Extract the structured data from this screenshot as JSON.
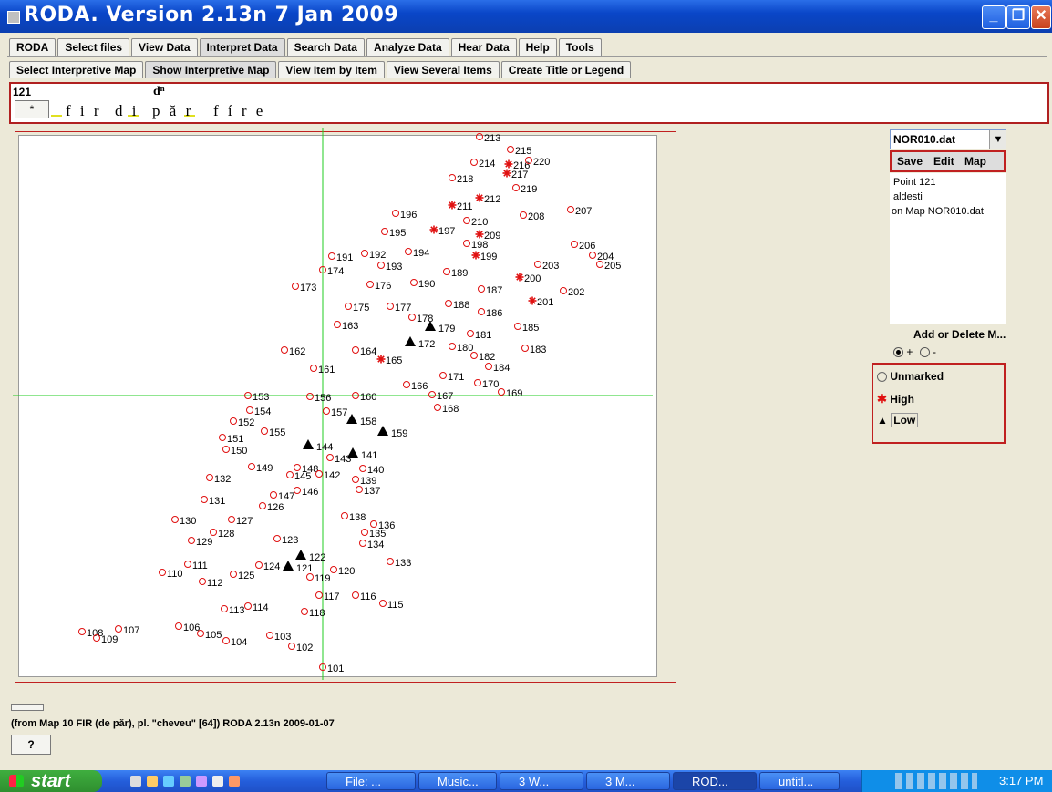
{
  "window": {
    "title": "RODA. Version 2.13n 7 Jan 2009"
  },
  "main_tabs": [
    {
      "label": "RODA"
    },
    {
      "label": "Select files"
    },
    {
      "label": "View Data"
    },
    {
      "label": "Interpret Data"
    },
    {
      "label": "Search Data"
    },
    {
      "label": "Analyze Data"
    },
    {
      "label": "Hear Data"
    },
    {
      "label": "Help"
    },
    {
      "label": "Tools"
    }
  ],
  "sub_tabs": [
    {
      "label": "Select Interpretive Map"
    },
    {
      "label": "Show Interpretive Map"
    },
    {
      "label": "View Item by Item"
    },
    {
      "label": "View Several Items"
    },
    {
      "label": "Create Title or Legend"
    }
  ],
  "header": {
    "item_number": "121",
    "star_button": "*",
    "transcription": "f i r  d i  p ă r   f í r e",
    "superscript": "dⁿ"
  },
  "map": {
    "crosshair": {
      "x_point": "101",
      "y_point": "153"
    },
    "points": [
      {
        "id": "213",
        "m": "u"
      },
      {
        "id": "215",
        "m": "u"
      },
      {
        "id": "214",
        "m": "u"
      },
      {
        "id": "216",
        "m": "h"
      },
      {
        "id": "220",
        "m": "u"
      },
      {
        "id": "217",
        "m": "h"
      },
      {
        "id": "218",
        "m": "u"
      },
      {
        "id": "219",
        "m": "u"
      },
      {
        "id": "212",
        "m": "h"
      },
      {
        "id": "211",
        "m": "h"
      },
      {
        "id": "207",
        "m": "u"
      },
      {
        "id": "208",
        "m": "u"
      },
      {
        "id": "196",
        "m": "u"
      },
      {
        "id": "210",
        "m": "u"
      },
      {
        "id": "195",
        "m": "u"
      },
      {
        "id": "197",
        "m": "h"
      },
      {
        "id": "209",
        "m": "h"
      },
      {
        "id": "198",
        "m": "u"
      },
      {
        "id": "206",
        "m": "u"
      },
      {
        "id": "191",
        "m": "u"
      },
      {
        "id": "192",
        "m": "u"
      },
      {
        "id": "194",
        "m": "u"
      },
      {
        "id": "199",
        "m": "h"
      },
      {
        "id": "204",
        "m": "u"
      },
      {
        "id": "203",
        "m": "u"
      },
      {
        "id": "205",
        "m": "u"
      },
      {
        "id": "174",
        "m": "u"
      },
      {
        "id": "193",
        "m": "u"
      },
      {
        "id": "189",
        "m": "u"
      },
      {
        "id": "200",
        "m": "h"
      },
      {
        "id": "173",
        "m": "u"
      },
      {
        "id": "176",
        "m": "u"
      },
      {
        "id": "190",
        "m": "u"
      },
      {
        "id": "187",
        "m": "u"
      },
      {
        "id": "202",
        "m": "u"
      },
      {
        "id": "201",
        "m": "h"
      },
      {
        "id": "175",
        "m": "u"
      },
      {
        "id": "177",
        "m": "u"
      },
      {
        "id": "188",
        "m": "u"
      },
      {
        "id": "186",
        "m": "u"
      },
      {
        "id": "178",
        "m": "u"
      },
      {
        "id": "163",
        "m": "u"
      },
      {
        "id": "185",
        "m": "u"
      },
      {
        "id": "179",
        "m": "l"
      },
      {
        "id": "181",
        "m": "u"
      },
      {
        "id": "172",
        "m": "l"
      },
      {
        "id": "180",
        "m": "u"
      },
      {
        "id": "183",
        "m": "u"
      },
      {
        "id": "162",
        "m": "u"
      },
      {
        "id": "164",
        "m": "u"
      },
      {
        "id": "182",
        "m": "u"
      },
      {
        "id": "165",
        "m": "h"
      },
      {
        "id": "184",
        "m": "u"
      },
      {
        "id": "161",
        "m": "u"
      },
      {
        "id": "171",
        "m": "u"
      },
      {
        "id": "166",
        "m": "u"
      },
      {
        "id": "170",
        "m": "u"
      },
      {
        "id": "167",
        "m": "u"
      },
      {
        "id": "169",
        "m": "u"
      },
      {
        "id": "153",
        "m": "u"
      },
      {
        "id": "156",
        "m": "u"
      },
      {
        "id": "160",
        "m": "u"
      },
      {
        "id": "168",
        "m": "u"
      },
      {
        "id": "154",
        "m": "u"
      },
      {
        "id": "157",
        "m": "u"
      },
      {
        "id": "152",
        "m": "u"
      },
      {
        "id": "158",
        "m": "l"
      },
      {
        "id": "155",
        "m": "u"
      },
      {
        "id": "159",
        "m": "l"
      },
      {
        "id": "151",
        "m": "u"
      },
      {
        "id": "150",
        "m": "u"
      },
      {
        "id": "144",
        "m": "l"
      },
      {
        "id": "143",
        "m": "u"
      },
      {
        "id": "141",
        "m": "l"
      },
      {
        "id": "149",
        "m": "u"
      },
      {
        "id": "148",
        "m": "u"
      },
      {
        "id": "140",
        "m": "u"
      },
      {
        "id": "132",
        "m": "u"
      },
      {
        "id": "145",
        "m": "u"
      },
      {
        "id": "142",
        "m": "u"
      },
      {
        "id": "139",
        "m": "u"
      },
      {
        "id": "146",
        "m": "u"
      },
      {
        "id": "137",
        "m": "u"
      },
      {
        "id": "147",
        "m": "u"
      },
      {
        "id": "131",
        "m": "u"
      },
      {
        "id": "126",
        "m": "u"
      },
      {
        "id": "138",
        "m": "u"
      },
      {
        "id": "136",
        "m": "u"
      },
      {
        "id": "130",
        "m": "u"
      },
      {
        "id": "127",
        "m": "u"
      },
      {
        "id": "135",
        "m": "u"
      },
      {
        "id": "128",
        "m": "u"
      },
      {
        "id": "134",
        "m": "u"
      },
      {
        "id": "129",
        "m": "u"
      },
      {
        "id": "123",
        "m": "u"
      },
      {
        "id": "122",
        "m": "l"
      },
      {
        "id": "133",
        "m": "u"
      },
      {
        "id": "124",
        "m": "u"
      },
      {
        "id": "121",
        "m": "l"
      },
      {
        "id": "111",
        "m": "u"
      },
      {
        "id": "120",
        "m": "u"
      },
      {
        "id": "110",
        "m": "u"
      },
      {
        "id": "125",
        "m": "u"
      },
      {
        "id": "119",
        "m": "u"
      },
      {
        "id": "112",
        "m": "u"
      },
      {
        "id": "117",
        "m": "u"
      },
      {
        "id": "116",
        "m": "u"
      },
      {
        "id": "115",
        "m": "u"
      },
      {
        "id": "113",
        "m": "u"
      },
      {
        "id": "114",
        "m": "u"
      },
      {
        "id": "118",
        "m": "u"
      },
      {
        "id": "106",
        "m": "u"
      },
      {
        "id": "107",
        "m": "u"
      },
      {
        "id": "108",
        "m": "u"
      },
      {
        "id": "105",
        "m": "u"
      },
      {
        "id": "103",
        "m": "u"
      },
      {
        "id": "109",
        "m": "u"
      },
      {
        "id": "104",
        "m": "u"
      },
      {
        "id": "102",
        "m": "u"
      },
      {
        "id": "101",
        "m": "u"
      }
    ]
  },
  "right_panel": {
    "file_select": "NOR010.dat",
    "buttons": {
      "save": "Save",
      "edit": "Edit",
      "map": "Map"
    },
    "info_lines": [
      "Point 121",
      "aldesti",
      "on Map NOR010.dat"
    ],
    "add_delete_label": "Add or Delete M...",
    "radio_plus": "+",
    "radio_minus": "-",
    "legend": [
      {
        "label": "Unmarked",
        "symbol": "radio"
      },
      {
        "label": "High",
        "symbol": "red-star"
      },
      {
        "label": "Low",
        "symbol": "black-triangle"
      }
    ]
  },
  "status": {
    "caption": "(from Map 10 FIR (de păr), pl. \"cheveu\" [64]) RODA 2.13n 2009-01-07",
    "help_button": "?"
  },
  "colors": {
    "title_bar": "#0a46c8",
    "marker_red": "#e01010",
    "crosshair": "#22cc22",
    "box_red": "#c02020"
  },
  "taskbar": {
    "start_label": "start",
    "items": [
      {
        "label": "File: ..."
      },
      {
        "label": "Music..."
      },
      {
        "label": "3 W..."
      },
      {
        "label": "3 M..."
      },
      {
        "label": "ROD..."
      },
      {
        "label": "untitl..."
      }
    ],
    "clock": "3:17 PM"
  }
}
